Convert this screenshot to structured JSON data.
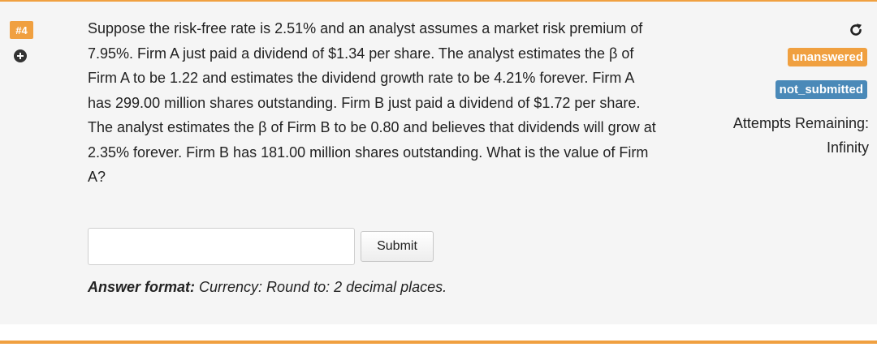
{
  "question": {
    "number": "#4",
    "text": "Suppose the risk-free rate is 2.51% and an analyst assumes a market risk premium of 7.95%. Firm A just paid a dividend of $1.34 per share. The analyst estimates the β of Firm A to be 1.22 and estimates the dividend growth rate to be 4.21% forever. Firm A has 299.00 million shares outstanding. Firm B just paid a dividend of $1.72 per share. The analyst estimates the β of Firm B to be 0.80 and believes that dividends will grow at 2.35% forever. Firm B has 181.00 million shares outstanding. What is the value of Firm A?"
  },
  "answer": {
    "value": "",
    "submit_label": "Submit",
    "format_label": "Answer format:",
    "format_text": " Currency: Round to: 2 decimal places."
  },
  "status": {
    "answer_state": "unanswered",
    "submission_state": "not_submitted",
    "attempts_label": "Attempts Remaining:",
    "attempts_value": "Infinity"
  },
  "icons": {
    "expand": "plus-circle-icon",
    "refresh": "refresh-icon"
  },
  "colors": {
    "accent": "#f0a040",
    "badge_blue": "#4a89b8",
    "panel_bg": "#f5f5f5"
  }
}
